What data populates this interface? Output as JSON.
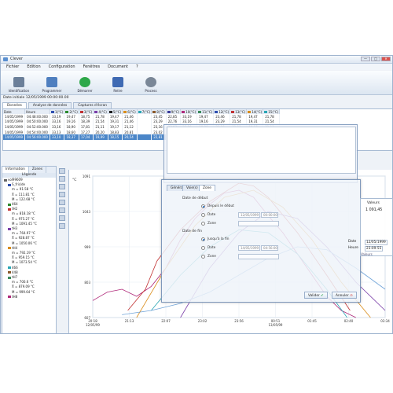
{
  "window": {
    "title": "Clever",
    "min_label": "—",
    "max_label": "□",
    "close_label": "✕"
  },
  "menu": [
    "Fichier",
    "Edition",
    "Configuration",
    "Fenêtres",
    "Document",
    "?"
  ],
  "toolbar": [
    {
      "label": "Identification",
      "icon": "glasses-icon",
      "color": "#6b7f99"
    },
    {
      "label": "Programmer",
      "icon": "laptop-icon",
      "color": "#4f7fbf"
    },
    {
      "label": "Démarrer",
      "icon": "play-icon",
      "color": "#2ea84a"
    },
    {
      "label": "Relire",
      "icon": "monitor-icon",
      "color": "#3f6ab3"
    },
    {
      "label": "Process",
      "icon": "gears-icon",
      "color": "#7a8797"
    }
  ],
  "date_initiale": "Date initiale 12/05/1999 00:00:00.00",
  "tabs": [
    "Données",
    "Analyse de données",
    "Captures d'écran"
  ],
  "table": {
    "headers": [
      "Date",
      "Heure",
      "1(°C)",
      "2(°C)",
      "3(°C)",
      "4(°C)",
      "5(°C)",
      "6(°C)",
      "7(°C)",
      "8(°C)",
      "9(°C)",
      "10(°C)",
      "11(°C)",
      "12(°C)",
      "13(°C)",
      "14(°C)",
      "15(°C)"
    ],
    "header_colors": [
      "",
      "",
      "#2f4fb0",
      "#2c8a2c",
      "#c23232",
      "#7a3ea8",
      "#1a1a1a",
      "#d98c1a",
      "#2aa6b5",
      "#8b5a2b",
      "#3a3a9a",
      "#b02a7a",
      "#3a8a5a",
      "#2f4fb0",
      "#c23232",
      "#d98c1a",
      "#2aa6b5"
    ],
    "rows": [
      [
        "14/05/1999",
        "04:48:00.000",
        "33,19",
        "19,47",
        "18,75",
        "21,78",
        "19,47",
        "21,46",
        "",
        "23,45",
        "22,85",
        "33,19",
        "19,47",
        "23,46",
        "21,78",
        "19,47",
        "21,78"
      ],
      [
        "14/05/1999",
        "04:50:00.000",
        "33,16",
        "19,16",
        "18,39",
        "21,54",
        "19,31",
        "21,46",
        "",
        "23,29",
        "22,76",
        "33,16",
        "19,16",
        "23,29",
        "21,54",
        "19,31",
        "21,54"
      ],
      [
        "14/05/1999",
        "04:52:00.000",
        "33,16",
        "18,90",
        "17,81",
        "21,11",
        "19,17",
        "21,12",
        "",
        "23,16",
        "22,63",
        "33,16",
        "18,90",
        "23,16",
        "21,11",
        "19,17",
        "21,11"
      ],
      [
        "14/05/1999",
        "04:54:00.000",
        "33,13",
        "18,60",
        "17,27",
        "20,20",
        "18,83",
        "20,81",
        "",
        "23,02",
        "22,46",
        "33,13",
        "18,60",
        "23,02",
        "20,20",
        "18,83",
        "21,44"
      ],
      [
        "14/05/1999",
        "04:56:00.000",
        "33,10",
        "18,37",
        "17,04",
        "19,99",
        "18,15",
        "20,54",
        "",
        "22,81",
        "22,32",
        "33,10",
        "18,37",
        "22,81",
        "19,99",
        "18,15",
        "20,90"
      ]
    ]
  },
  "left_panel": {
    "tabs": [
      "Information",
      "Zones"
    ],
    "legend_title": "Légende",
    "tree": [
      {
        "text": "vol99609",
        "indent": 0,
        "color": "#666"
      },
      {
        "text": "S_fricide",
        "indent": 1,
        "color": "#2f4fb0"
      },
      {
        "text": "m = 91.58 °C",
        "indent": 2,
        "color": ""
      },
      {
        "text": "X̄ = 111.81 °C",
        "indent": 2,
        "color": ""
      },
      {
        "text": "M = 122.68 °C",
        "indent": 2,
        "color": ""
      },
      {
        "text": "464",
        "indent": 1,
        "color": "#2c8a2c"
      },
      {
        "text": "tH2",
        "indent": 1,
        "color": "#c23232"
      },
      {
        "text": "m = 818.18 °C",
        "indent": 2,
        "color": ""
      },
      {
        "text": "X̄ = 975.27 °C",
        "indent": 2,
        "color": ""
      },
      {
        "text": "M = 1091.45 °C",
        "indent": 2,
        "color": ""
      },
      {
        "text": "tH3",
        "indent": 1,
        "color": "#7a3ea8"
      },
      {
        "text": "m = 764.97 °C",
        "indent": 2,
        "color": ""
      },
      {
        "text": "X̄ = 928.87 °C",
        "indent": 2,
        "color": ""
      },
      {
        "text": "M = 1050.06 °C",
        "indent": 2,
        "color": ""
      },
      {
        "text": "tH4",
        "indent": 1,
        "color": "#d98c1a"
      },
      {
        "text": "m = 792.19 °C",
        "indent": 2,
        "color": ""
      },
      {
        "text": "X̄ = 959.15 °C",
        "indent": 2,
        "color": ""
      },
      {
        "text": "M = 1073.54 °C",
        "indent": 2,
        "color": ""
      },
      {
        "text": "466",
        "indent": 1,
        "color": "#2aa6b5"
      },
      {
        "text": "448",
        "indent": 1,
        "color": "#8b5a2b"
      },
      {
        "text": "tH7",
        "indent": 1,
        "color": "#3a8a5a"
      },
      {
        "text": "m = 700.6 °C",
        "indent": 2,
        "color": ""
      },
      {
        "text": "X̄ = 879.09 °C",
        "indent": 2,
        "color": ""
      },
      {
        "text": "M = 999.64 °C",
        "indent": 2,
        "color": ""
      },
      {
        "text": "tH8",
        "indent": 1,
        "color": "#b02a7a"
      }
    ]
  },
  "chart_data": {
    "type": "line",
    "ylabel": "°C",
    "ytick_labels": [
      "1091",
      "1043",
      "999",
      "803",
      "607"
    ],
    "xtick_labels": [
      "20:18\n12/05/99",
      "21:13",
      "22:07",
      "23:02",
      "23:56",
      "00:51\n13/05/99",
      "01:45",
      "02:40",
      "03:34"
    ],
    "series": [
      {
        "color": "#b02a7a",
        "x": [
          0,
          0.05,
          0.1,
          0.15,
          0.2,
          0.25,
          0.3,
          0.35,
          0.4,
          0.45,
          0.5,
          0.55,
          0.6,
          0.65,
          0.7,
          0.75,
          0.8,
          0.85,
          0.9
        ],
        "y": [
          0.12,
          0.18,
          0.2,
          0.15,
          0.22,
          0.35,
          0.55,
          0.7,
          0.8,
          0.88,
          0.9,
          0.85,
          0.72,
          0.6,
          0.45,
          0.3,
          0.15,
          0.05,
          0.0
        ]
      },
      {
        "color": "#c23232",
        "x": [
          0.12,
          0.18,
          0.22,
          0.3,
          0.4,
          0.5,
          0.55,
          0.6,
          0.7,
          0.8,
          0.88
        ],
        "y": [
          0.05,
          0.2,
          0.4,
          0.62,
          0.82,
          0.95,
          0.93,
          0.85,
          0.6,
          0.3,
          0.05
        ]
      },
      {
        "color": "#d98c1a",
        "x": [
          0.15,
          0.25,
          0.35,
          0.45,
          0.55,
          0.65,
          0.75,
          0.85,
          0.95
        ],
        "y": [
          0.0,
          0.35,
          0.65,
          0.85,
          0.9,
          0.78,
          0.55,
          0.25,
          0.0
        ]
      },
      {
        "color": "#2aa6b5",
        "x": [
          0.2,
          0.3,
          0.4,
          0.5,
          0.6,
          0.7,
          0.8,
          0.87
        ],
        "y": [
          0.05,
          0.3,
          0.5,
          0.62,
          0.6,
          0.45,
          0.2,
          0.0
        ]
      },
      {
        "color": "#7a3ea8",
        "x": [
          0.3,
          0.4,
          0.5,
          0.6,
          0.7,
          0.8,
          0.9,
          1.0
        ],
        "y": [
          0.0,
          0.35,
          0.6,
          0.75,
          0.7,
          0.5,
          0.25,
          0.05
        ]
      },
      {
        "color": "#6fa3d8",
        "x": [
          0.1,
          0.2,
          0.3,
          0.4,
          0.5,
          0.6,
          0.7,
          0.8,
          0.9,
          1.0
        ],
        "y": [
          0.02,
          0.05,
          0.1,
          0.18,
          0.3,
          0.42,
          0.5,
          0.48,
          0.35,
          0.2
        ]
      }
    ]
  },
  "dialog_back": {
    "title": ""
  },
  "dialog": {
    "tabs": [
      "Général",
      "Voie(s)",
      "Zone"
    ],
    "start_group": "Date de début",
    "start_options": [
      "Depuis le début",
      "Date",
      "Zone"
    ],
    "start_date": "12/05/1999",
    "start_time": "00:00:00",
    "end_group": "Date de fin",
    "end_options": [
      "Jusqu'à la fin",
      "Date",
      "Zone"
    ],
    "end_date": "14/05/1999",
    "end_time": "04:56:00",
    "validate_label": "Valider",
    "cancel_label": "Annuler"
  },
  "right_box": {
    "header": "Valeurs",
    "value": "1 091,45",
    "date_label": "Date",
    "date_value": "12/05/1999",
    "time_label": "Heure",
    "time_value": "23:09:55",
    "footer": "Valeurs"
  }
}
